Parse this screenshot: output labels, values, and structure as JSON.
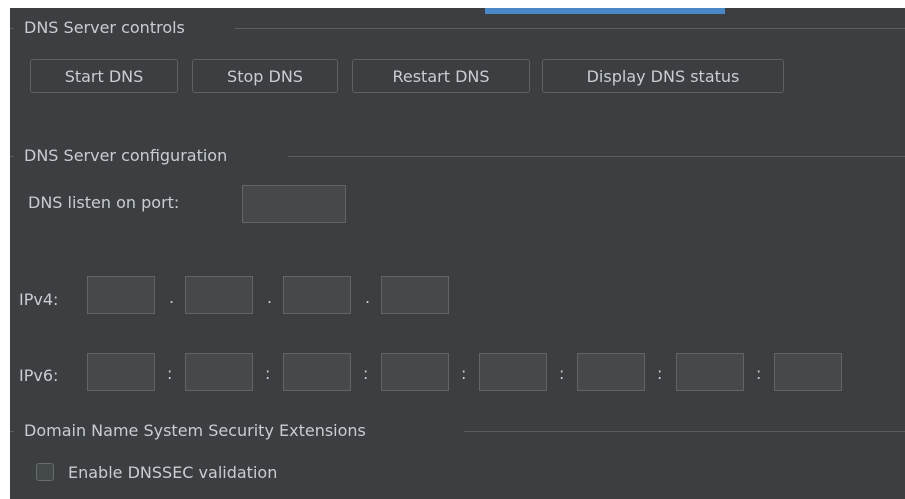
{
  "controls": {
    "title": "DNS Server controls",
    "buttons": {
      "start": "Start DNS",
      "stop": "Stop DNS",
      "restart": "Restart DNS",
      "status": "Display DNS status"
    }
  },
  "configuration": {
    "title": "DNS Server configuration",
    "port_label": "DNS listen on port:",
    "port_value": "",
    "ipv4_label": "IPv4:",
    "ipv4_separator": ".",
    "ipv4_octets": [
      "",
      "",
      "",
      ""
    ],
    "ipv6_label": "IPv6:",
    "ipv6_separator": ":",
    "ipv6_groups": [
      "",
      "",
      "",
      "",
      "",
      "",
      "",
      ""
    ]
  },
  "dnssec": {
    "title": "Domain Name System Security Extensions",
    "checkbox_label": "Enable DNSSEC validation",
    "checked": false
  }
}
